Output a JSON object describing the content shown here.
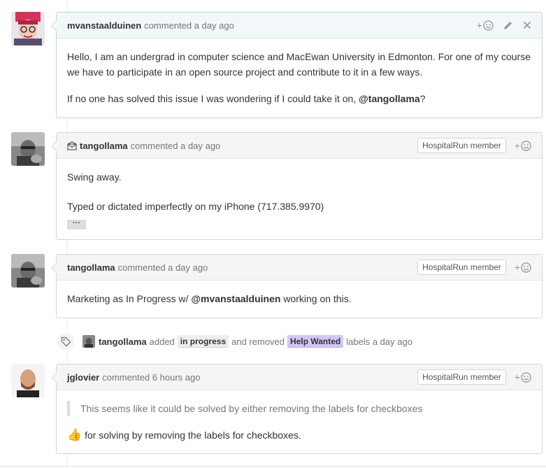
{
  "comments": [
    {
      "author": "mvanstaalduinen",
      "action": "commented",
      "time": "a day ago",
      "paragraphs": [
        "Hello, I am an undergrad in computer science and MacEwan University in Edmonton. For one of my course we have to participate in an open source project and contribute to it in a few ways."
      ],
      "last_line_prefix": "If no one has solved this issue I was wondering if I could take it on, ",
      "last_line_mention": "@tangollama",
      "last_line_suffix": "?"
    },
    {
      "author": "tangollama",
      "action": "commented",
      "time": "a day ago",
      "badge": "HospitalRun member",
      "line1": "Swing away.",
      "line2": "Typed or dictated imperfectly on my iPhone (717.385.9970)",
      "ellipsis": "···"
    },
    {
      "author": "tangollama",
      "action": "commented",
      "time": "a day ago",
      "badge": "HospitalRun member",
      "prefix": "Marketing as In Progress w/ ",
      "mention": "@mvanstaalduinen",
      "suffix": " working on this."
    },
    {
      "author": "jglovier",
      "action": "commented",
      "time": "6 hours ago",
      "badge": "HospitalRun member",
      "quote": "This seems like it could be solved by either removing the labels for checkboxes",
      "emoji": "👍",
      "text": "for solving by removing the labels for checkboxes."
    }
  ],
  "event": {
    "actor": "tangollama",
    "added": "added",
    "label_added": "in progress",
    "and_removed": "and removed",
    "label_removed": "Help Wanted",
    "suffix": "labels a day ago"
  },
  "icons": {
    "reaction": "smiley-icon",
    "edit": "pencil-icon",
    "delete": "close-icon",
    "email": "envelope-icon",
    "tag": "tag-icon"
  },
  "colors": {
    "label_help_wanted": "#d4c5f9",
    "label_in_progress": "#ededed",
    "own_header": "#f2f8fa"
  }
}
